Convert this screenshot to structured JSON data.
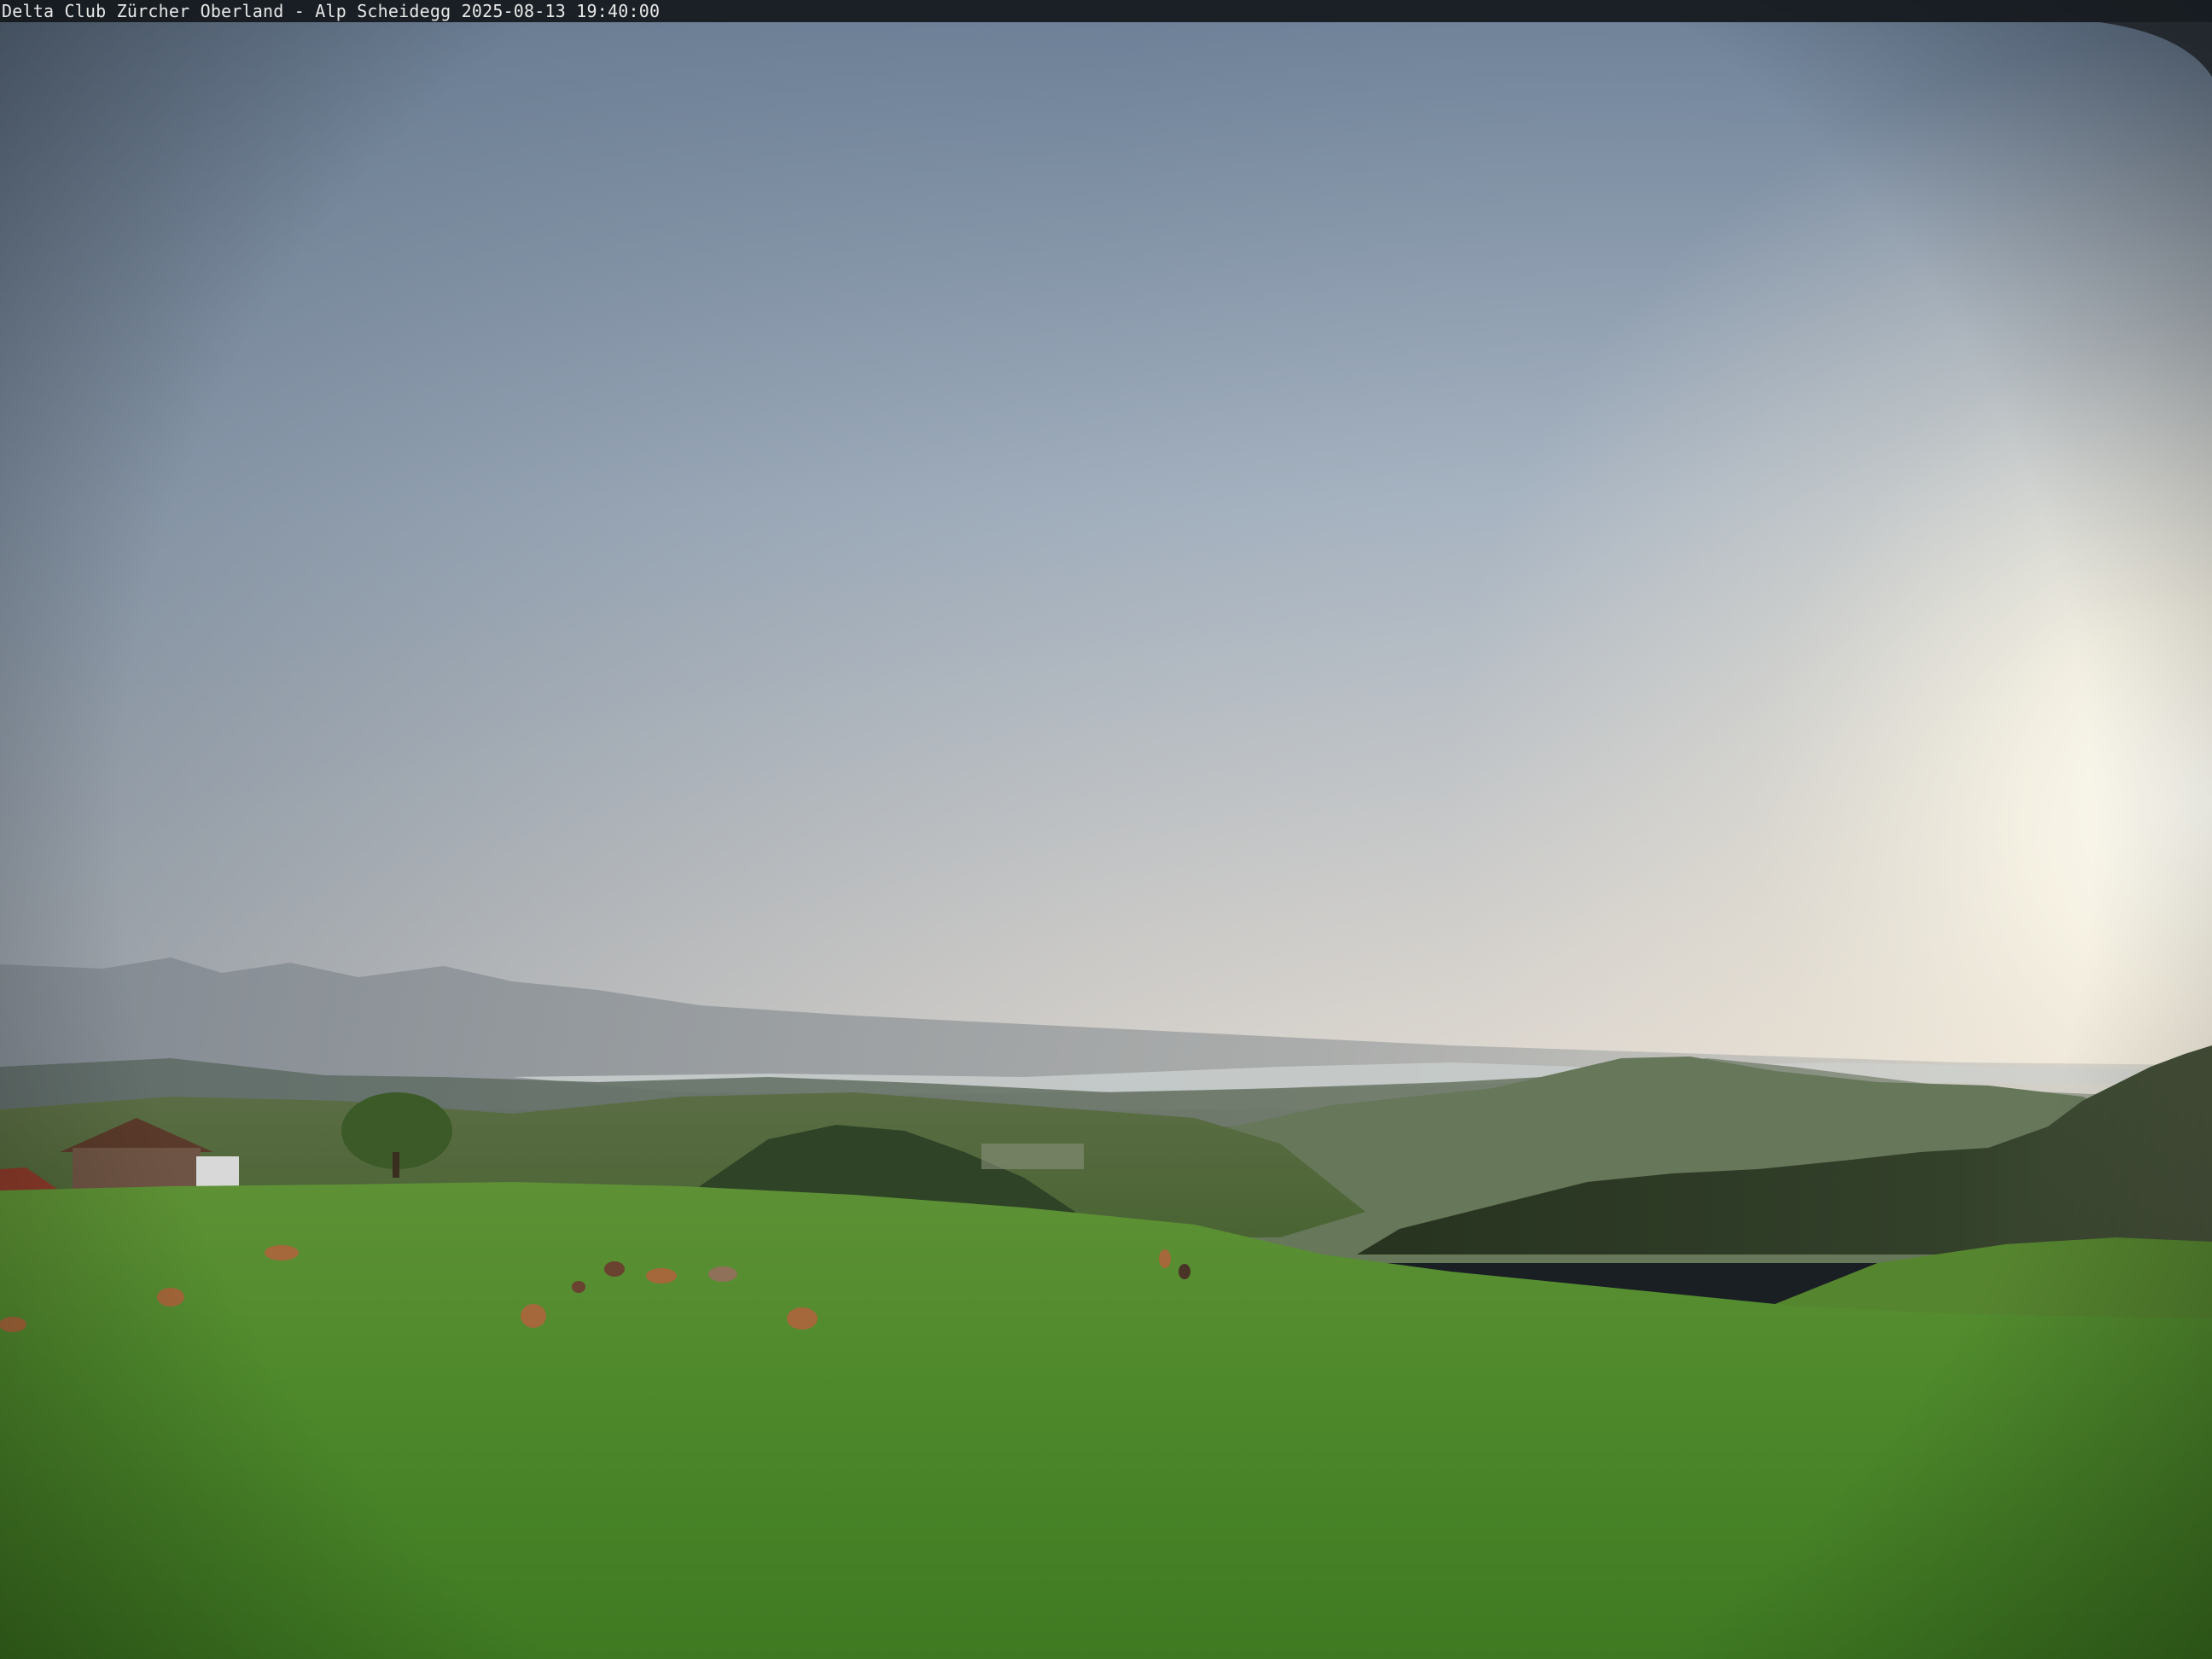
{
  "overlay": {
    "caption": "Delta Club Zürcher Oberland - Alp Scheidegg 2025-08-13 19:40:00"
  },
  "scene": {
    "sky_top_color": "#6f8399",
    "sky_mid_color": "#b3bcc6",
    "sky_horizon_color": "#e8ddcf",
    "sun_glow_color": "#fffdf4",
    "haze_mountains_color": "#8d949a",
    "lake_color": "#c9cfcf",
    "forest_color": "#2d3b25",
    "meadow_far_color": "#5c8b36",
    "meadow_near_color": "#4f8a2a",
    "cattle_color": "#a5683a"
  }
}
